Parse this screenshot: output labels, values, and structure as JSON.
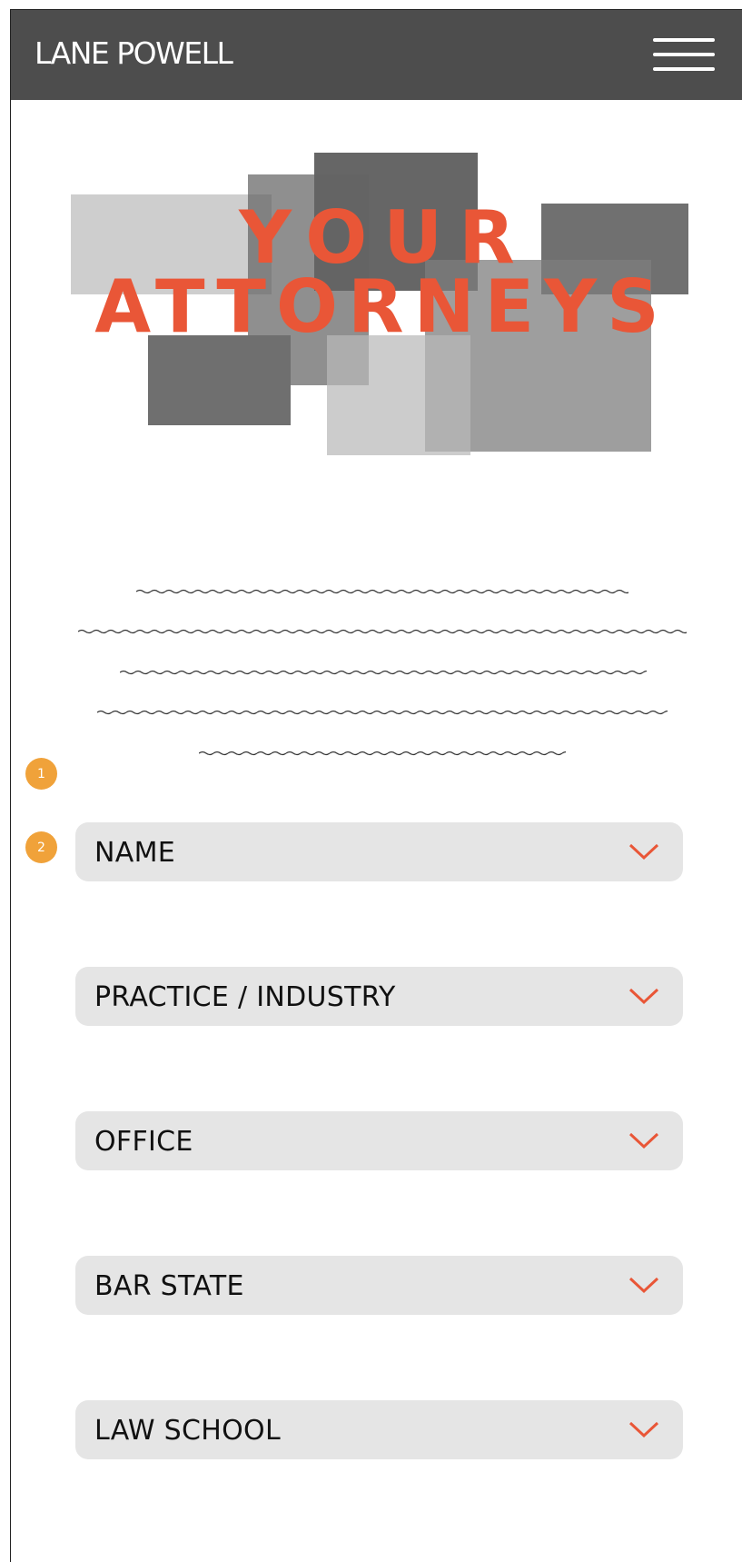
{
  "header": {
    "logo": "LANE POWELL",
    "menu_icon": "hamburger-menu-icon"
  },
  "hero": {
    "title_line1": "YOUR",
    "title_line2": "ATTORNEYS",
    "accent_color": "#e95637"
  },
  "badges": [
    "1",
    "2"
  ],
  "filters": [
    {
      "label": "NAME",
      "icon": "chevron-down-icon"
    },
    {
      "label": "PRACTICE / INDUSTRY",
      "icon": "chevron-down-icon"
    },
    {
      "label": "OFFICE",
      "icon": "chevron-down-icon"
    },
    {
      "label": "BAR STATE",
      "icon": "chevron-down-icon"
    },
    {
      "label": "LAW SCHOOL",
      "icon": "chevron-down-icon"
    }
  ],
  "colors": {
    "header_bg": "#4d4d4d",
    "badge": "#f0a23a",
    "filter_bg": "#e5e5e5"
  }
}
